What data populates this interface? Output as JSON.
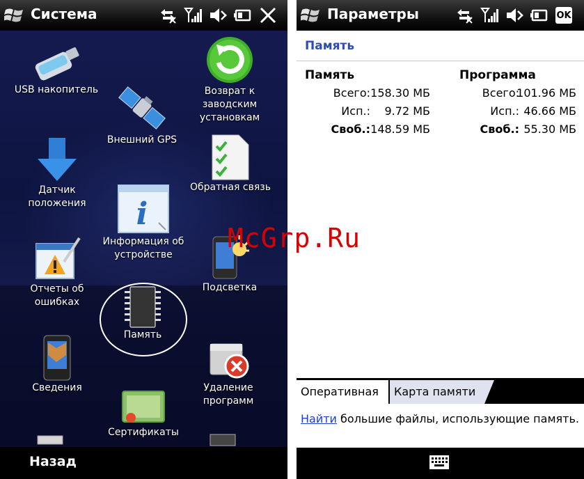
{
  "left": {
    "title": "Система",
    "back_label": "Назад",
    "apps": [
      {
        "id": "usb",
        "label": "USB накопитель"
      },
      {
        "id": "reset",
        "label": "Возврат к\nзаводским\nустановкам"
      },
      {
        "id": "gps",
        "label": "Внешний GPS"
      },
      {
        "id": "sensor",
        "label": "Датчик\nположения"
      },
      {
        "id": "feedback",
        "label": "Обратная связь"
      },
      {
        "id": "info",
        "label": "Информация об\nустройстве"
      },
      {
        "id": "errors",
        "label": "Отчеты об\nошибках"
      },
      {
        "id": "backlight",
        "label": "Подсветка"
      },
      {
        "id": "memory",
        "label": "Память"
      },
      {
        "id": "about",
        "label": "Сведения"
      },
      {
        "id": "uninstall",
        "label": "Удаление\nпрограмм"
      },
      {
        "id": "certs",
        "label": "Сертификаты"
      }
    ]
  },
  "right": {
    "title": "Параметры",
    "ok_label": "OK",
    "section": "Память",
    "storage": {
      "header": "Память",
      "total_label": "Всего:",
      "total": "158.30 МБ",
      "used_label": "Исп.:",
      "used": "9.72 МБ",
      "free_label": "Своб.:",
      "free": "148.59 МБ"
    },
    "program": {
      "header": "Программа",
      "total_label": "Всего:",
      "total": "101.96 МБ",
      "used_label": "Исп.:",
      "used": "46.66 МБ",
      "free_label": "Своб.:",
      "free": "55.30 МБ"
    },
    "tabs": [
      {
        "label": "Оперативная"
      },
      {
        "label": "Карта памяти"
      }
    ],
    "hint_link": "Найти",
    "hint_text": " большие файлы, использующие память."
  },
  "watermark": "McGrp.Ru",
  "colors": {
    "accent_blue": "#2c4db8",
    "link_blue": "#1a3ed6",
    "watermark_red": "#d80000"
  },
  "icons": [
    "windows-logo",
    "sync-icon",
    "signal-icon",
    "speaker-mute-icon",
    "battery-icon",
    "close-icon",
    "keyboard-icon"
  ]
}
